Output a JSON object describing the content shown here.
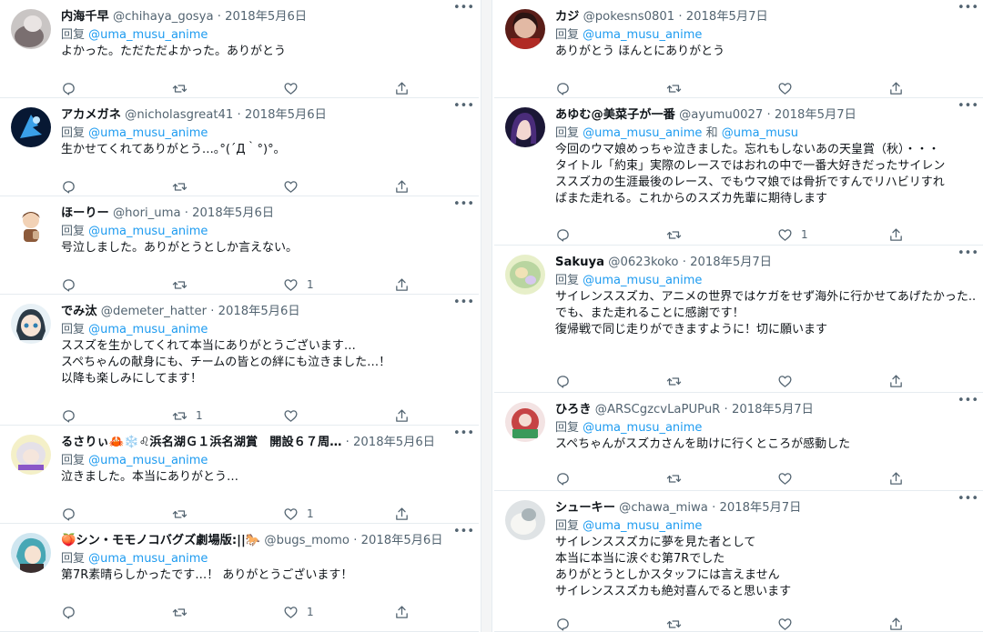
{
  "reply_label": "回复",
  "left_tweets": [
    {
      "name": "内海千早",
      "handle": "@chihaya_gosya",
      "date": "2018年5月6日",
      "reply_to": "@uma_musu_anime",
      "reply_to2": "",
      "lines": [
        "よかった。ただただよかった。ありがとう"
      ],
      "reply_count": "",
      "retweet_count": "",
      "like_count": ""
    },
    {
      "name": "アカメガネ",
      "handle": "@nicholasgreat41",
      "date": "2018年5月6日",
      "reply_to": "@uma_musu_anime",
      "reply_to2": "",
      "lines": [
        "生かせてくれてありがとう…｡°(´Д｀°)°｡"
      ],
      "reply_count": "",
      "retweet_count": "",
      "like_count": ""
    },
    {
      "name": "ほーりー",
      "handle": "@hori_uma",
      "date": "2018年5月6日",
      "reply_to": "@uma_musu_anime",
      "reply_to2": "",
      "lines": [
        "号泣しました。ありがとうとしか言えない。"
      ],
      "reply_count": "",
      "retweet_count": "",
      "like_count": "1"
    },
    {
      "name": "でみ汰",
      "handle": "@demeter_hatter",
      "date": "2018年5月6日",
      "reply_to": "@uma_musu_anime",
      "reply_to2": "",
      "lines": [
        "ススズを生かしてくれて本当にありがとうございます…",
        "スペちゃんの献身にも、チームの皆との絆にも泣きました…！",
        "以降も楽しみにしてます！"
      ],
      "reply_count": "",
      "retweet_count": "1",
      "like_count": ""
    },
    {
      "name": "るさりぃ🦀❄️♌浜名湖Ｇ１浜名湖賞　開設６７周…",
      "handle": "",
      "date": "2018年5月6日",
      "reply_to": "@uma_musu_anime",
      "reply_to2": "",
      "lines": [
        "泣きました。本当にありがとう…"
      ],
      "reply_count": "",
      "retweet_count": "",
      "like_count": "1"
    },
    {
      "name": "🍑シン・モモノコバグズ劇場版:||🐎",
      "handle": "@bugs_momo",
      "date": "2018年5月6日",
      "reply_to": "@uma_musu_anime",
      "reply_to2": "",
      "lines": [
        "第7R素晴らしかったです…！ ありがとうございます！"
      ],
      "reply_count": "",
      "retweet_count": "",
      "like_count": "1"
    }
  ],
  "right_tweets": [
    {
      "name": "カジ",
      "handle": "@pokesns0801",
      "date": "2018年5月7日",
      "reply_to": "@uma_musu_anime",
      "reply_to2": "",
      "lines": [
        "ありがとう ほんとにありがとう"
      ],
      "reply_count": "",
      "retweet_count": "",
      "like_count": ""
    },
    {
      "name": "あゆむ@美菜子が一番",
      "handle": "@ayumu0027",
      "date": "2018年5月7日",
      "reply_to": "@uma_musu_anime",
      "reply_to2": "@uma_musu",
      "lines": [
        "今回のウマ娘めっちゃ泣きました。忘れもしないあの天皇賞（秋）・・・",
        "タイトル「約束」実際のレースではおれの中で一番大好きだったサイレン",
        "ススズカの生涯最後のレース、でもウマ娘では骨折ですんでリハビリすれ",
        "ばまた走れる。これからのスズカ先輩に期待します"
      ],
      "reply_count": "",
      "retweet_count": "",
      "like_count": "1"
    },
    {
      "name": "Sakuya",
      "handle": "@0623koko",
      "date": "2018年5月7日",
      "reply_to": "@uma_musu_anime",
      "reply_to2": "",
      "lines": [
        "サイレンススズカ、アニメの世界ではケガをせず海外に行かせてあげたかった..",
        "でも、また走れることに感謝です！",
        "復帰戦で同じ走りができますように！切に願います"
      ],
      "reply_count": "",
      "retweet_count": "",
      "like_count": ""
    },
    {
      "name": "ひろき",
      "handle": "@ARSCgzcvLaPUPuR",
      "date": "2018年5月7日",
      "reply_to": "@uma_musu_anime",
      "reply_to2": "",
      "lines": [
        "スペちゃんがスズカさんを助けに行くところが感動した"
      ],
      "reply_count": "",
      "retweet_count": "",
      "like_count": ""
    },
    {
      "name": "シューキー",
      "handle": "@chawa_miwa",
      "date": "2018年5月7日",
      "reply_to": "@uma_musu_anime",
      "reply_to2": "",
      "lines": [
        "サイレンススズカに夢を見た者として",
        "本当に本当に涙ぐむ第7Rでした",
        "ありがとうとしかスタッフには言えません",
        "サイレンススズカも絶対喜んでると思います"
      ],
      "reply_count": "",
      "retweet_count": "",
      "like_count": ""
    }
  ],
  "and_label": "和",
  "colors": {
    "link": "#1d9bf0",
    "muted": "#536471",
    "text": "#0f1419",
    "divider": "#e6ecf0"
  },
  "icons": [
    "reply-icon",
    "retweet-icon",
    "like-icon",
    "share-icon",
    "more-icon"
  ]
}
